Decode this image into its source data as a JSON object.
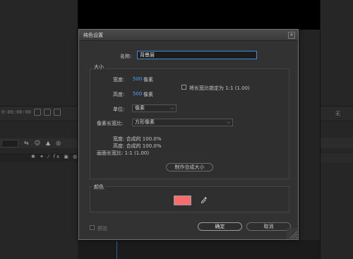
{
  "background": {
    "timecode": "0:00:00:00",
    "right_label": "无"
  },
  "dialog": {
    "title": "纯色设置",
    "close_label": "×",
    "name_label": "名称:",
    "name_value": "背景层",
    "size_legend": "大小",
    "width_label": "宽度:",
    "width_value": "500",
    "width_unit": "像素",
    "height_label": "高度:",
    "height_value": "500",
    "height_unit": "像素",
    "lock_label": "将长宽比锁定为 1:1 (1.00)",
    "units_label": "单位:",
    "units_value": "像素",
    "pixel_aspect_label": "像素长宽比:",
    "pixel_aspect_value": "方形像素",
    "info_width": "宽度:  合成的 100.0%",
    "info_height": "高度:  合成的 100.0%",
    "info_frame_aspect": "画面长宽比:  1:1 (1.00)",
    "make_comp_size_label": "制作合成大小",
    "color_legend": "颜色",
    "color_value": "#f86c6c",
    "preview_label": "预览",
    "ok_label": "确定",
    "cancel_label": "取消"
  }
}
